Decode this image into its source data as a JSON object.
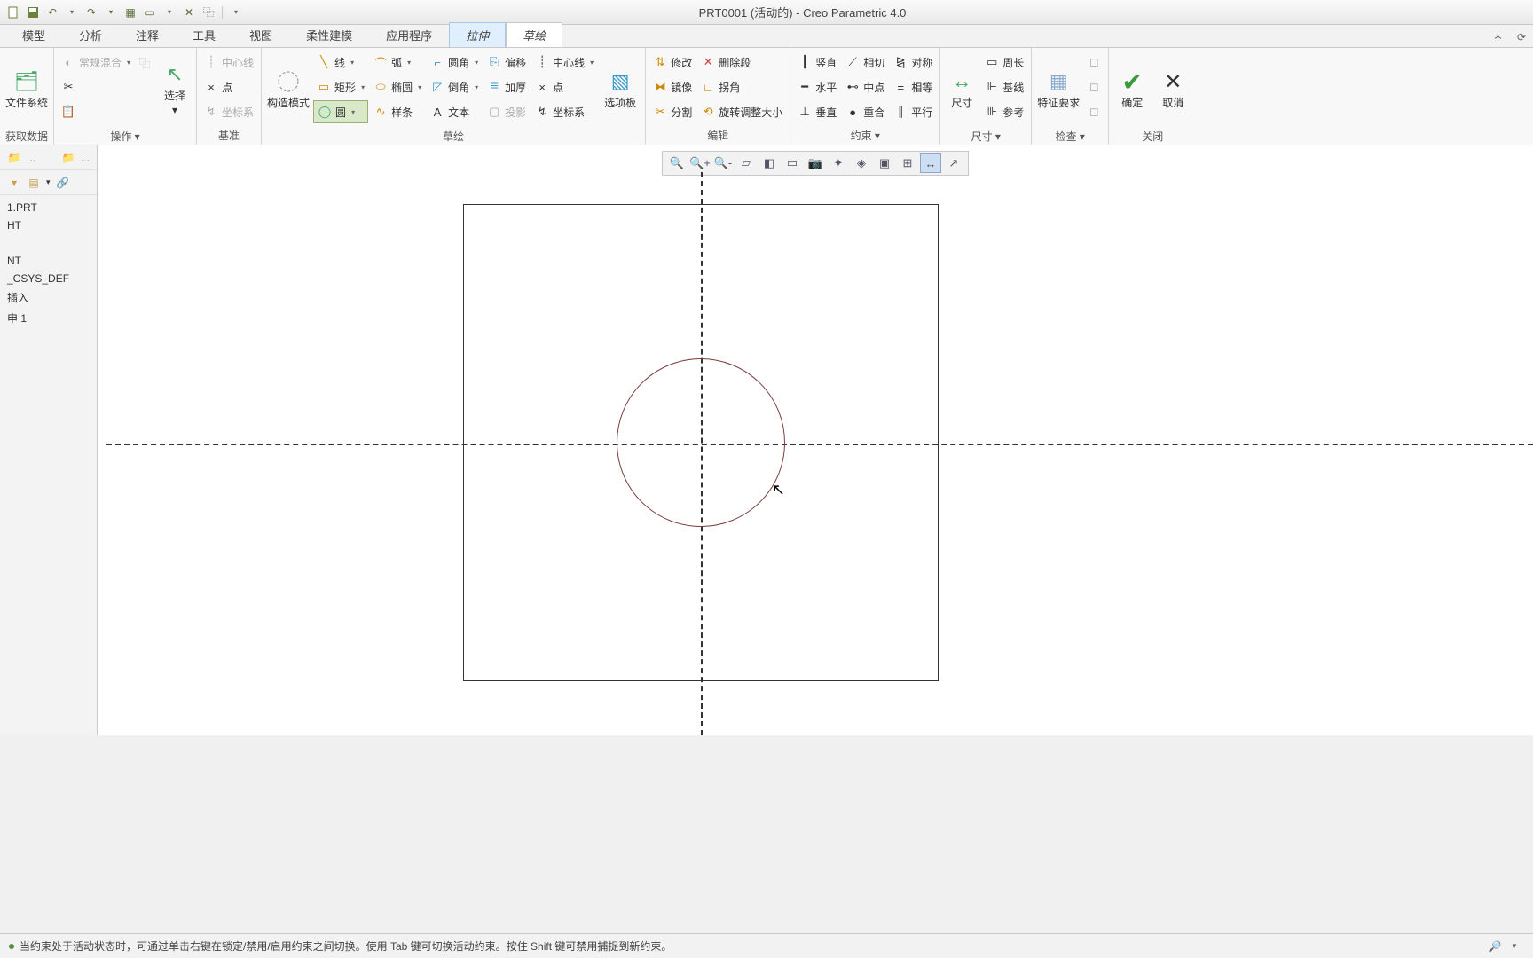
{
  "title": "PRT0001 (活动的) - Creo Parametric 4.0",
  "qat_dd": "▾",
  "tabs": {
    "model": "模型",
    "analyze": "分析",
    "annotate": "注释",
    "tools": "工具",
    "view": "视图",
    "flex": "柔性建模",
    "apps": "应用程序",
    "extrude": "拉伸",
    "sketch": "草绘"
  },
  "groups": {
    "get_data": "获取数据",
    "ops": "操作 ▾",
    "datum": "基准",
    "sketch": "草绘",
    "edit": "编辑",
    "constrain": "约束 ▾",
    "dim": "尺寸 ▾",
    "inspect": "检查 ▾",
    "close": "关闭"
  },
  "btn": {
    "filesys": "文件系统",
    "blend": "常规混合",
    "select": "选择",
    "centerline": "中心线",
    "point": "点",
    "csys": "坐标系",
    "construct": "构造模式",
    "line": "线",
    "arc": "弧",
    "fillet": "圆角",
    "offset": "偏移",
    "centerline2": "中心线",
    "rect": "矩形",
    "ellipse": "椭圆",
    "chamfer": "倒角",
    "thicken": "加厚",
    "point2": "点",
    "circle": "圆",
    "spline": "样条",
    "text": "文本",
    "project": "投影",
    "csys2": "坐标系",
    "palette": "选项板",
    "modify": "修改",
    "delete_seg": "删除段",
    "mirror": "镜像",
    "corner": "拐角",
    "divide": "分割",
    "rotate_resize": "旋转调整大小",
    "vertical": "竖直",
    "tangent": "相切",
    "symmetric": "对称",
    "horizontal": "水平",
    "midpoint": "中点",
    "equal": "相等",
    "perpendicular": "垂直",
    "coincident": "重合",
    "parallel": "平行",
    "dim_tool": "尺寸",
    "perimeter": "周长",
    "baseline": "基线",
    "reference": "参考",
    "feat_req": "特征要求",
    "ok": "确定",
    "cancel": "取消"
  },
  "tree": {
    "i0": "1.PRT",
    "i1": "HT",
    "i2": "NT",
    "i3": "_CSYS_DEF",
    "i4": "插入",
    "i5": "申 1"
  },
  "status": {
    "msg": "当约束处于活动状态时，可通过单击右键在锁定/禁用/启用约束之间切换。使用 Tab 键可切换活动约束。按住 Shift 键可禁用捕捉到新约束。"
  }
}
